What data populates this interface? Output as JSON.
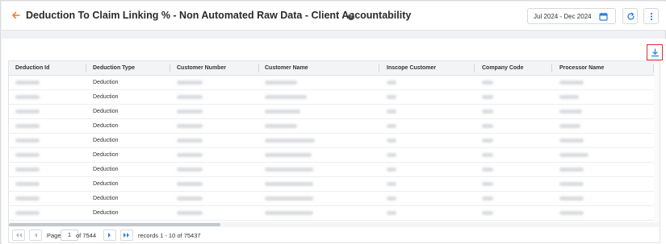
{
  "header": {
    "title": "Deduction To Claim Linking % - Non Automated Raw Data - Client Accountability",
    "help_glyph": "?",
    "date_range": "Jul 2024 - Dec 2024",
    "accent_color": "#f07a1f"
  },
  "table": {
    "columns": [
      "Deduction Id",
      "Deduction Type",
      "Customer Number",
      "Customer Name",
      "Inscope Customer",
      "Company Code",
      "Processor Name"
    ],
    "rows": [
      {
        "deduction_type": "Deduction"
      },
      {
        "deduction_type": "Deduction"
      },
      {
        "deduction_type": "Deduction"
      },
      {
        "deduction_type": "Deduction"
      },
      {
        "deduction_type": "Deduction"
      },
      {
        "deduction_type": "Deduction"
      },
      {
        "deduction_type": "Deduction"
      },
      {
        "deduction_type": "Deduction"
      },
      {
        "deduction_type": "Deduction"
      },
      {
        "deduction_type": "Deduction"
      }
    ]
  },
  "pagination": {
    "page_label": "Page",
    "current_page": "1",
    "of_pages": "of 7544",
    "records": "records 1 - 10 of 75437"
  },
  "icons": {
    "back": "arrow-left-icon",
    "help": "question-circle-icon",
    "calendar": "calendar-icon",
    "refresh": "refresh-icon",
    "more": "more-vertical-icon",
    "download": "download-icon",
    "first": "first-page-icon",
    "prev": "previous-page-icon",
    "next": "next-page-icon",
    "last": "last-page-icon"
  },
  "colors": {
    "primary": "#2f7de0",
    "download_highlight": "#e02b2b"
  }
}
